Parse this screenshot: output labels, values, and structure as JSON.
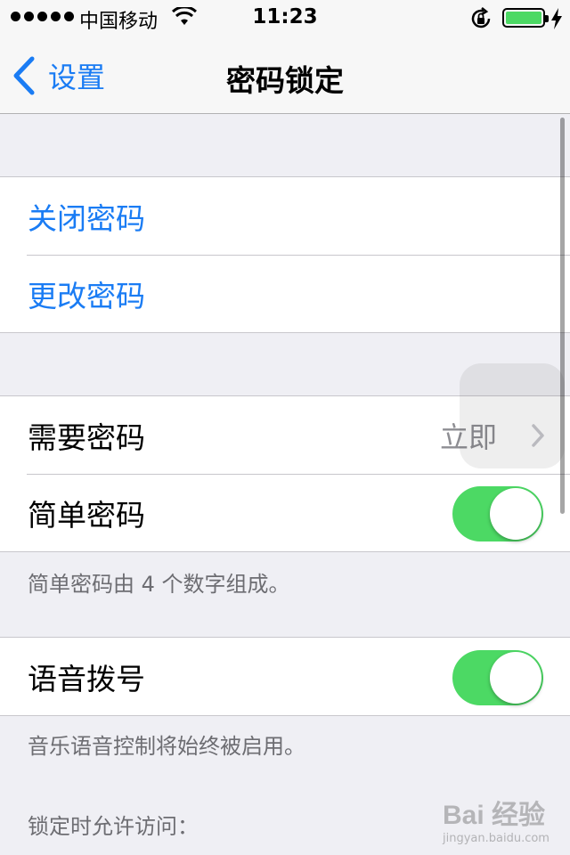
{
  "status_bar": {
    "carrier": "中国移动",
    "time": "11:23",
    "battery_level": 1.0,
    "battery_color": "#4cd964"
  },
  "nav": {
    "back_label": "设置",
    "title": "密码锁定",
    "accent": "#1a7cf4"
  },
  "section_passcode": {
    "items": [
      {
        "label": "关闭密码"
      },
      {
        "label": "更改密码"
      }
    ]
  },
  "section_settings": {
    "require_passcode": {
      "label": "需要密码",
      "value": "立即"
    },
    "simple_passcode": {
      "label": "简单密码",
      "on": true
    },
    "footnote": "简单密码由 4 个数字组成。"
  },
  "section_voice": {
    "voice_dial": {
      "label": "语音拨号",
      "on": true
    },
    "footnote": "音乐语音控制将始终被启用。"
  },
  "section_locked_access": {
    "header": "锁定时允许访问："
  },
  "watermark": {
    "logo": "Bai 经验",
    "url": "jingyan.baidu.com"
  }
}
